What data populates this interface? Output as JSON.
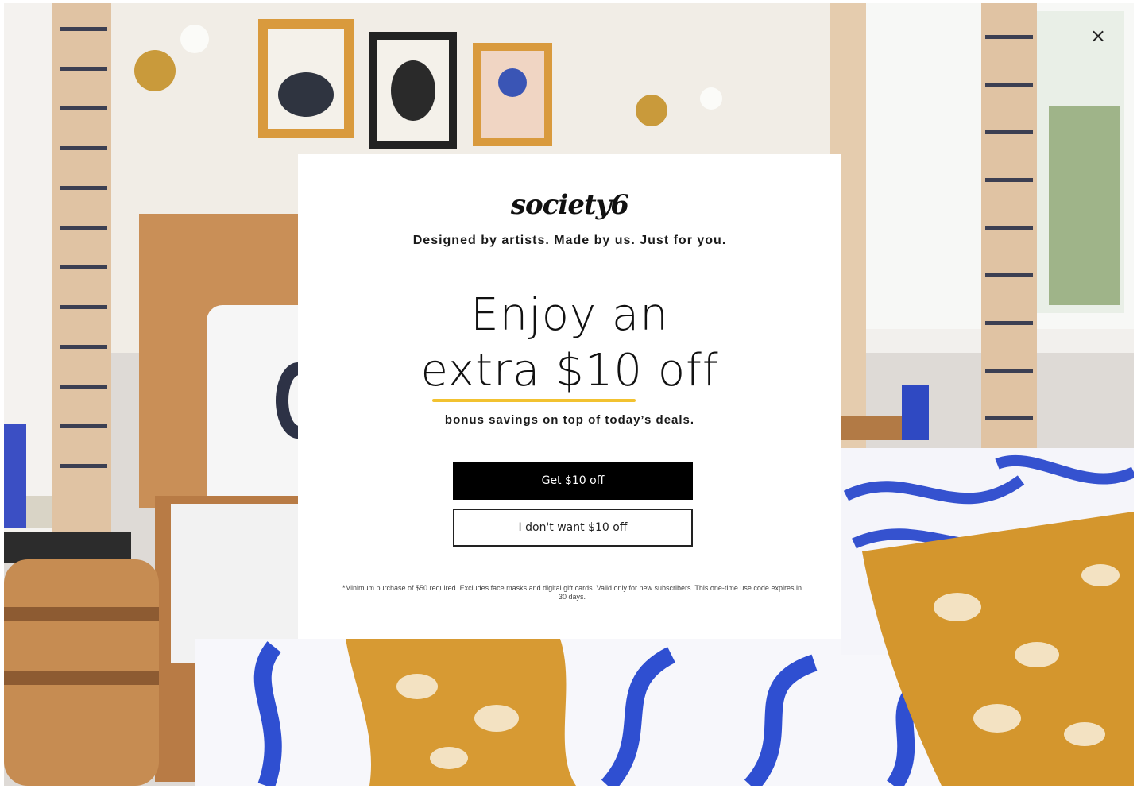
{
  "modal": {
    "close_icon": "close-icon",
    "close_glyph": "×",
    "brand": "society6",
    "tagline": "Designed by artists. Made by us. Just for you.",
    "headline_line1": "Enjoy an",
    "headline_line2": "extra $10 off",
    "subline": "bonus savings on top of today’s deals.",
    "primary_button": "Get $10 off",
    "secondary_button": "I don't want $10 off",
    "disclaimer": "*Minimum purchase of $50 required. Excludes face masks and digital gift cards. Valid only for new subscribers. This one-time use code expires in 30 days."
  },
  "colors": {
    "accent_underline": "#f2c230",
    "primary_button_bg": "#000000",
    "primary_button_text": "#ffffff",
    "card_bg": "#ffffff"
  },
  "background": {
    "subject": "bedroom-photo"
  }
}
